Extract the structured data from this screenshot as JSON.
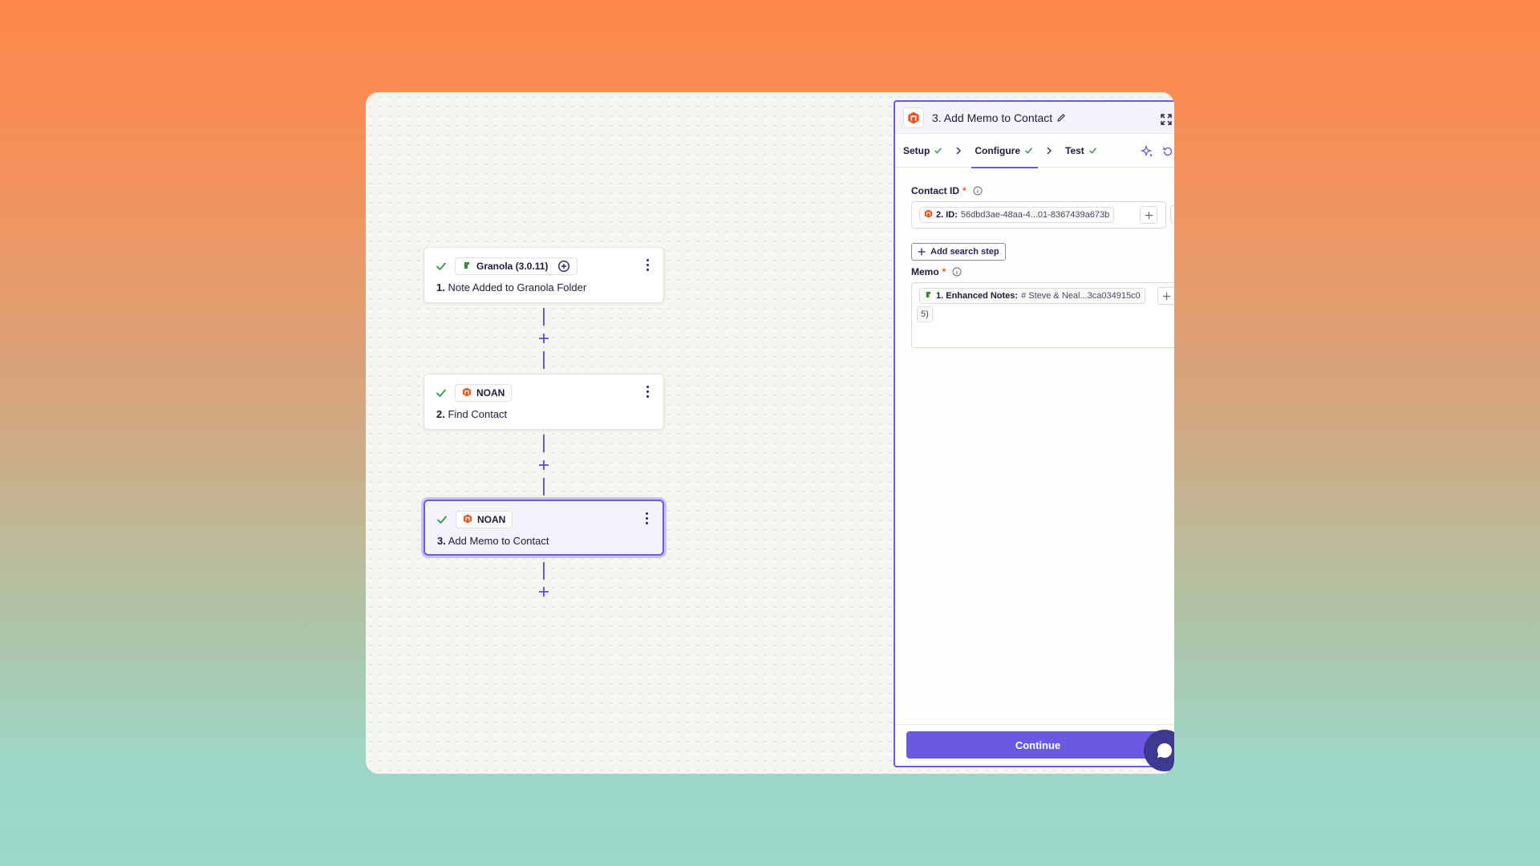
{
  "colors": {
    "accent": "#6b5bd6",
    "check": "#2e9a4e",
    "noan_brand": "#e2571e",
    "granola_brand": "#3b8a2e"
  },
  "canvas": {
    "steps": [
      {
        "status_icon": "check-icon",
        "app_icon": "granola-logo-icon",
        "app_name": "Granola (3.0.11)",
        "number": "1.",
        "title": "Note Added to Granola Folder"
      },
      {
        "status_icon": "check-icon",
        "app_icon": "noan-logo-icon",
        "app_name": "NOAN",
        "number": "2.",
        "title": "Find Contact"
      },
      {
        "status_icon": "check-icon",
        "app_icon": "noan-logo-icon",
        "app_name": "NOAN",
        "number": "3.",
        "title": "Add Memo to Contact"
      }
    ]
  },
  "panel": {
    "title": "3. Add Memo to Contact",
    "tabs": [
      {
        "label": "Setup",
        "done": true
      },
      {
        "label": "Configure",
        "done": true,
        "active": true
      },
      {
        "label": "Test",
        "done": true
      }
    ],
    "contact_id": {
      "label": "Contact ID",
      "required_mark": "*",
      "pill_key": "2. ID:",
      "pill_value": "56dbd3ae-48aa-4...01-8367439a673b"
    },
    "add_search_step_label": "Add search step",
    "memo": {
      "label": "Memo",
      "required_mark": "*",
      "pill_key": "1. Enhanced Notes:",
      "pill_value": "# Steve & Neal...3ca034915c0",
      "overflow_text": "5)"
    },
    "continue_label": "Continue"
  }
}
